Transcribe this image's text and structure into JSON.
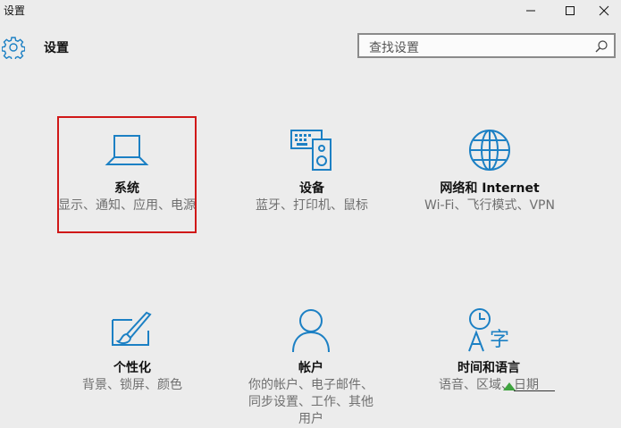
{
  "window": {
    "title": "设置"
  },
  "header": {
    "title": "设置",
    "icon": "gear-icon"
  },
  "search": {
    "placeholder": "查找设置",
    "icon": "search-icon"
  },
  "colors": {
    "accent": "#1c80c4",
    "selection_border": "#d01818",
    "annotation_green": "#3fa33f"
  },
  "tiles": [
    {
      "name": "系统",
      "desc": "显示、通知、应用、电源",
      "icon": "laptop-icon",
      "selected": true
    },
    {
      "name": "设备",
      "desc": "蓝牙、打印机、鼠标",
      "icon": "devices-icon"
    },
    {
      "name": "网络和 Internet",
      "desc": "Wi-Fi、飞行模式、VPN",
      "icon": "globe-icon"
    },
    {
      "name": "个性化",
      "desc": "背景、锁屏、颜色",
      "icon": "paint-icon"
    },
    {
      "name": "帐户",
      "desc": "你的帐户、电子邮件、同步设置、工作、其他用户",
      "icon": "person-icon"
    },
    {
      "name": "时间和语言",
      "desc": "语音、区域、日期",
      "icon": "time-language-icon"
    }
  ]
}
